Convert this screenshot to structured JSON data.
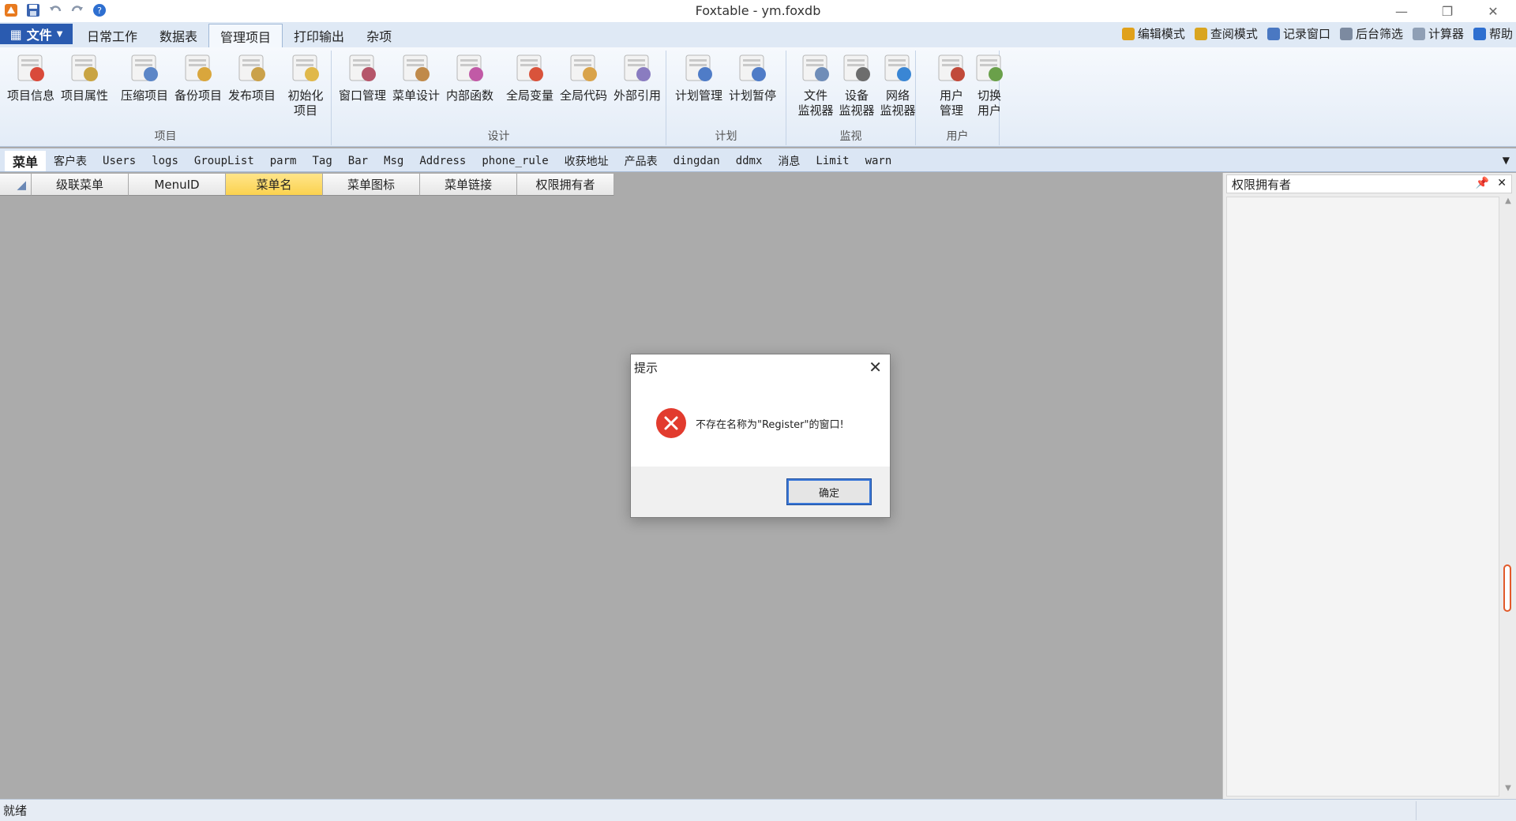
{
  "window": {
    "title": "Foxtable - ym.foxdb",
    "controls": {
      "minimize": "—",
      "restore": "❐",
      "close": "✕"
    }
  },
  "ribbon_tabs": {
    "file_label": "文件",
    "tabs": [
      {
        "label": "日常工作"
      },
      {
        "label": "数据表"
      },
      {
        "label": "管理项目"
      },
      {
        "label": "打印输出"
      },
      {
        "label": "杂项"
      }
    ],
    "active_tab": "管理项目"
  },
  "right_tools": [
    {
      "label": "编辑模式",
      "color": "#e0a11b"
    },
    {
      "label": "查阅模式",
      "color": "#d9a520"
    },
    {
      "label": "记录窗口",
      "color": "#4a78c2"
    },
    {
      "label": "后台筛选",
      "color": "#7c8aa0"
    },
    {
      "label": "计算器",
      "color": "#8f9fb5"
    },
    {
      "label": "帮助",
      "color": "#2e6fd0"
    }
  ],
  "ribbon": {
    "groups": [
      {
        "label": "项目"
      },
      {
        "label": "设计"
      },
      {
        "label": "计划"
      },
      {
        "label": "监视"
      },
      {
        "label": "用户"
      }
    ],
    "buttons": [
      {
        "label": "项目信息",
        "color": "#d94a3a"
      },
      {
        "label": "项目属性",
        "color": "#c9a442"
      },
      {
        "label": "压缩项目",
        "color": "#5c86c7"
      },
      {
        "label": "备份项目",
        "color": "#d9a63c"
      },
      {
        "label": "发布项目",
        "color": "#caa14a"
      },
      {
        "label": "初始化",
        "label2": "项目",
        "color": "#e0b84a"
      },
      {
        "label": "窗口管理",
        "color": "#b5566a"
      },
      {
        "label": "菜单设计",
        "color": "#c08a4a"
      },
      {
        "label": "内部函数",
        "color": "#c15aa6"
      },
      {
        "label": "全局变量",
        "color": "#d9533b"
      },
      {
        "label": "全局代码",
        "color": "#d9a34a"
      },
      {
        "label": "外部引用",
        "color": "#8a7cc0"
      },
      {
        "label": "计划管理",
        "color": "#4f7cc7"
      },
      {
        "label": "计划暂停",
        "color": "#4f7cc7"
      },
      {
        "label": "文件",
        "label2": "监视器",
        "color": "#6f8db8"
      },
      {
        "label": "设备",
        "label2": "监视器",
        "color": "#6d6d6d"
      },
      {
        "label": "网络",
        "label2": "监视器",
        "color": "#3a86d4"
      },
      {
        "label": "用户",
        "label2": "管理",
        "color": "#c14a3a"
      },
      {
        "label": "切换",
        "label2": "用户",
        "color": "#6aa04a"
      }
    ]
  },
  "table_tabs": [
    "菜单",
    "客户表",
    "Users",
    "logs",
    "GroupList",
    "parm",
    "Tag",
    "Bar",
    "Msg",
    "Address",
    "phone_rule",
    "收获地址",
    "产品表",
    "dingdan",
    "ddmx",
    "消息",
    "Limit",
    "warn"
  ],
  "grid": {
    "columns": [
      "级联菜单",
      "MenuID",
      "菜单名",
      "菜单图标",
      "菜单链接",
      "权限拥有者"
    ],
    "selected_column": "菜单名"
  },
  "side_panel": {
    "title": "权限拥有者",
    "pin": "📌",
    "close": "✕"
  },
  "status": {
    "text": "就绪"
  },
  "dialog": {
    "title": "提示",
    "message": "不存在名称为\"Register\"的窗口!",
    "ok_label": "确定",
    "close": "✕"
  }
}
